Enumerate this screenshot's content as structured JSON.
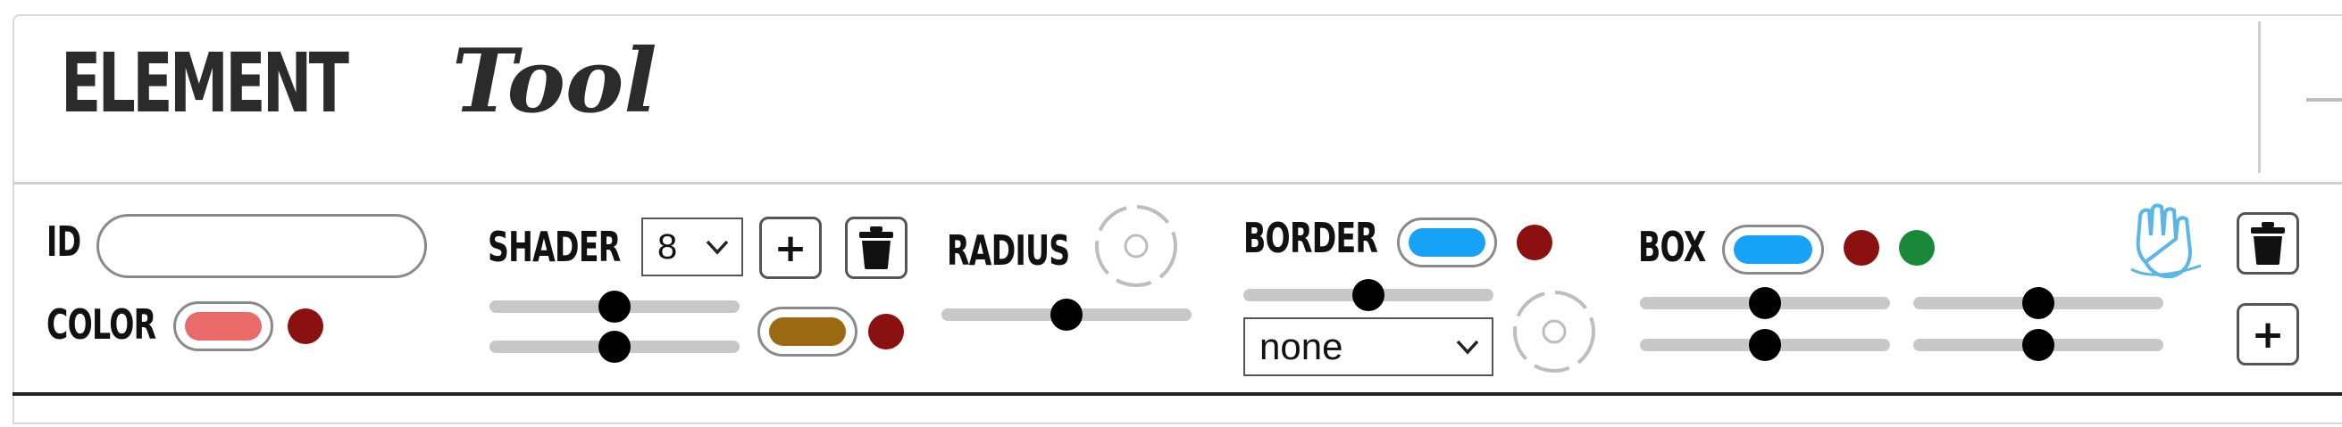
{
  "title": {
    "part1": "ELEMENT",
    "part2": "Tool"
  },
  "icons": {
    "chevron": "chevron-down-icon",
    "trash": "trash-icon",
    "plus": "plus-icon",
    "radius_dial": "dashed-circle-icon",
    "cursor_hand": "hand-cursor-icon"
  },
  "id_section": {
    "label": "ID",
    "value": "",
    "placeholder": ""
  },
  "color_section": {
    "label": "COLOR",
    "swatch_color": "#ea6a6a",
    "dot_color": "#8b1111"
  },
  "shader_section": {
    "label": "SHADER",
    "select_value": "8",
    "add_label": "+",
    "slider1_value": 0.5,
    "slider2_value": 0.5,
    "swatch_color": "#9c6a12",
    "dot_color": "#8b1111"
  },
  "radius_section": {
    "label": "RADIUS",
    "slider_value": 0.5
  },
  "border_section": {
    "label": "BORDER",
    "swatch_color": "#16a2f7",
    "dot_color": "#8b1111",
    "slider_value": 0.5,
    "style_value": "none"
  },
  "box_section": {
    "label": "BOX",
    "swatch_color": "#16a2f7",
    "dot_color1": "#8b1111",
    "dot_color2": "#1a8a3a",
    "slider1_value": 0.5,
    "slider2_value": 0.5,
    "slider3_value": 0.5,
    "slider4_value": 0.5,
    "add_label": "+"
  }
}
